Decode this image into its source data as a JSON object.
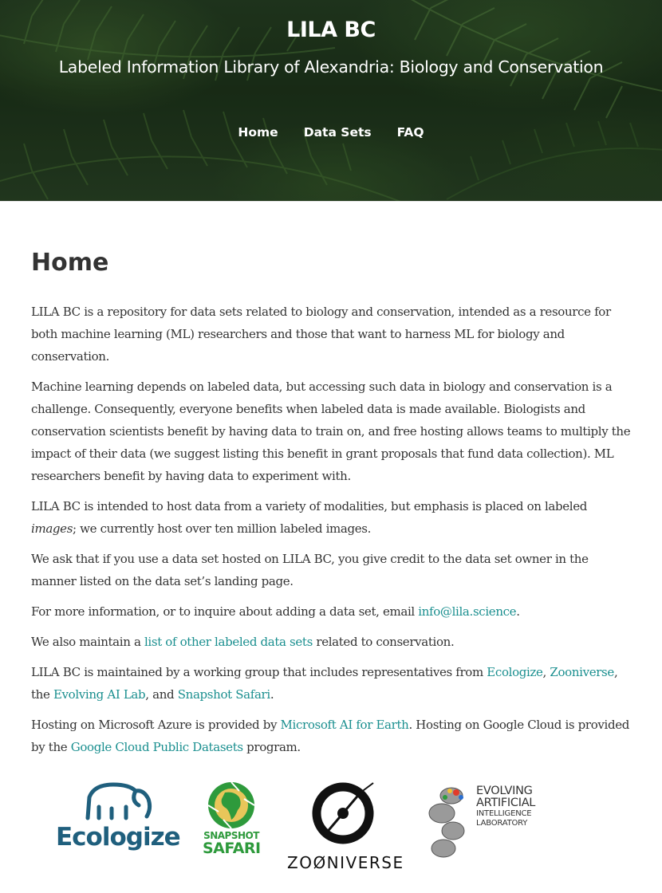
{
  "header": {
    "title": "LILA BC",
    "subtitle": "Labeled Information Library of Alexandria: Biology and Conservation",
    "nav": [
      {
        "label": "Home"
      },
      {
        "label": "Data Sets"
      },
      {
        "label": "FAQ"
      }
    ]
  },
  "main": {
    "page_title": "Home",
    "p1": "LILA BC is a repository for data sets related to biology and conservation, intended as a resource for both machine learning (ML) researchers and those that want to harness ML for biology and conservation.",
    "p2": "Machine learning depends on labeled data, but accessing such data in biology and conservation is a challenge. Consequently, everyone benefits when labeled data is made available. Biologists and conservation scientists benefit by having data to train on, and free hosting allows teams to multiply the impact of their data (we suggest listing this benefit in grant proposals that fund data collection). ML researchers benefit by having data to experiment with.",
    "p3_a": "LILA BC is intended to host data from a variety of modalities, but emphasis is placed on labeled ",
    "p3_em": "images",
    "p3_b": "; we currently host over ten million labeled images.",
    "p4": "We ask that if you use a data set hosted on LILA BC, you give credit to the data set owner in the manner listed on the data set’s landing page.",
    "p5_a": "For more information, or to inquire about adding a data set, email ",
    "p5_link": "info@lila.science",
    "p5_b": ".",
    "p6_a": "We also maintain a ",
    "p6_link": "list of other labeled data sets",
    "p6_b": " related to conservation.",
    "p7_a": "LILA BC is maintained by a working group that includes representatives from ",
    "p7_link1": "Ecologize",
    "p7_sep1": ", ",
    "p7_link2": "Zooniverse",
    "p7_sep2": ", the ",
    "p7_link3": "Evolving AI Lab",
    "p7_sep3": ", and ",
    "p7_link4": "Snapshot Safari",
    "p7_end": ".",
    "p8_a": "Hosting on Microsoft Azure is provided by ",
    "p8_link1": "Microsoft AI for Earth",
    "p8_b": ". Hosting on Google Cloud is provided by the ",
    "p8_link2": "Google Cloud Public Datasets",
    "p8_c": " program."
  },
  "logos": {
    "ecologize": "Ecologize",
    "safari_line1": "SNAPSHOT",
    "safari_line2": "SAFARI",
    "zooniverse": "ZOØNIVERSE",
    "evolving_1": "EVOLVING",
    "evolving_2": "ARTIFICIAL",
    "evolving_3": "INTELLIGENCE",
    "evolving_4": "LABORATORY"
  },
  "colors": {
    "link": "#1a8f8f",
    "hero_green": "#233a20",
    "ecologize_blue": "#1f5f7d",
    "safari_green": "#2e9a3c"
  }
}
